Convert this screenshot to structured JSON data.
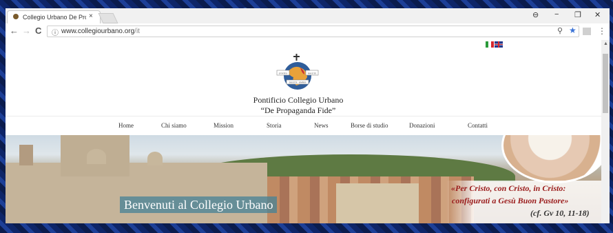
{
  "browser": {
    "tab_title": "Collegio Urbano De Prop",
    "tab_close": "×",
    "url_domain": "www.collegiourbano.org",
    "url_path": "/it",
    "win_profile": "⊖",
    "win_minimize": "−",
    "win_restore": "❐",
    "win_close": "✕",
    "back": "←",
    "forward": "→",
    "reload": "C",
    "info": "ⓘ",
    "zoom": "⚲",
    "star": "★",
    "menu": "⋮"
  },
  "site": {
    "name_line1": "Pontificio Collegio Urbano",
    "name_line2": "“De Propaganda Fide”",
    "logo_banner_left": "EVNTES",
    "logo_banner_right": "DOCETE",
    "logo_banner_bottom": "DOCETE · OMNES"
  },
  "menu": [
    "Home",
    "Chi siamo",
    "Mission",
    "Storia",
    "News",
    "Borse di studio",
    "Donazioni",
    "Contatti"
  ],
  "hero": {
    "welcome": "Benvenuti al Collegio Urbano",
    "quote_line1": "«Per Cristo, con Cristo, in Cristo:",
    "quote_line2": "configurati a Gesù Buon Pastore»",
    "quote_ref": "(cf. Gv 10, 11-18)"
  }
}
